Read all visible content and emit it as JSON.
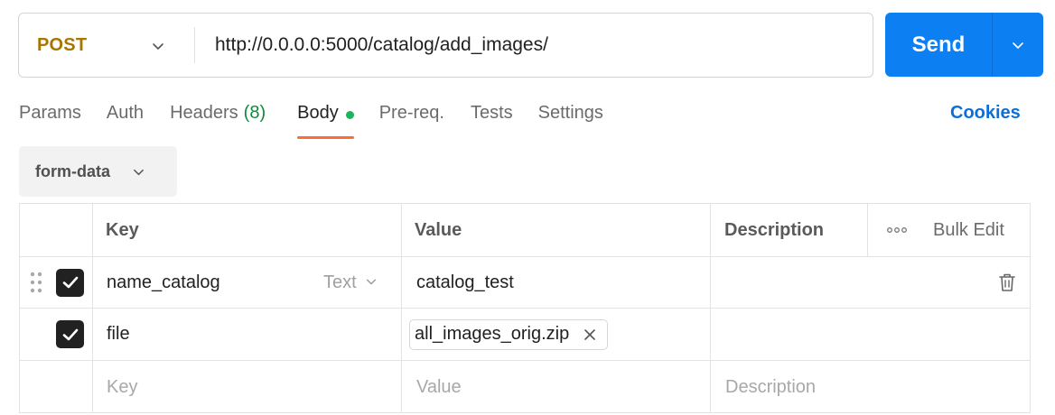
{
  "request": {
    "method": "POST",
    "url": "http://0.0.0.0:5000/catalog/add_images/",
    "send_label": "Send"
  },
  "tabs": [
    {
      "label": "Params"
    },
    {
      "label": "Auth"
    },
    {
      "label": "Headers",
      "count": "(8)"
    },
    {
      "label": "Body",
      "active": true
    },
    {
      "label": "Pre-req."
    },
    {
      "label": "Tests"
    },
    {
      "label": "Settings"
    }
  ],
  "cookies_label": "Cookies",
  "body_type": "form-data",
  "table": {
    "headers": {
      "key": "Key",
      "value": "Value",
      "description": "Description",
      "bulk_edit": "Bulk Edit"
    },
    "rows": [
      {
        "key": "name_catalog",
        "type": "Text",
        "value": "catalog_test",
        "description": ""
      },
      {
        "key": "file",
        "value": "all_images_orig.zip",
        "description": ""
      }
    ],
    "placeholders": {
      "key": "Key",
      "value": "Value",
      "description": "Description"
    }
  },
  "colors": {
    "method": "#a87600",
    "send": "#0c7ff2",
    "active_tab_underline": "#ff6c37",
    "body_dot": "#1bb55c",
    "headers_count": "#0f8a3c",
    "cookies": "#0c6fd9"
  },
  "icons": {
    "method_dropdown": "chevron-down-icon",
    "send_dropdown": "chevron-down-icon",
    "drag_handle": "drag-handle-icon",
    "checkbox": "checkmark-icon",
    "delete": "trash-icon",
    "remove_file": "close-icon",
    "more": "more-horizontal-icon"
  }
}
